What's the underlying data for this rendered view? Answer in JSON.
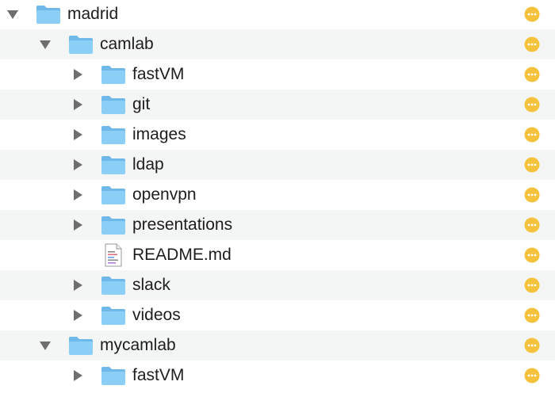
{
  "rows": [
    {
      "label": "madrid",
      "level": 0,
      "kind": "folder",
      "expanded": true
    },
    {
      "label": "camlab",
      "level": 1,
      "kind": "folder",
      "expanded": true
    },
    {
      "label": "fastVM",
      "level": 2,
      "kind": "folder",
      "expanded": false
    },
    {
      "label": "git",
      "level": 2,
      "kind": "folder",
      "expanded": false
    },
    {
      "label": "images",
      "level": 2,
      "kind": "folder",
      "expanded": false
    },
    {
      "label": "ldap",
      "level": 2,
      "kind": "folder",
      "expanded": false
    },
    {
      "label": "openvpn",
      "level": 2,
      "kind": "folder",
      "expanded": false
    },
    {
      "label": "presentations",
      "level": 2,
      "kind": "folder",
      "expanded": false
    },
    {
      "label": "README.md",
      "level": 2,
      "kind": "file",
      "expanded": false
    },
    {
      "label": "slack",
      "level": 2,
      "kind": "folder",
      "expanded": false
    },
    {
      "label": "videos",
      "level": 2,
      "kind": "folder",
      "expanded": false
    },
    {
      "label": "mycamlab",
      "level": 1,
      "kind": "folder",
      "expanded": true
    },
    {
      "label": "fastVM",
      "level": 2,
      "kind": "folder",
      "expanded": false
    }
  ],
  "icons": {
    "folder": "folder-icon",
    "file": "document-icon",
    "expanded": "disclosure-expanded-icon",
    "collapsed": "disclosure-collapsed-icon",
    "action": "more-options-icon"
  },
  "colors": {
    "folder_fill": "#8ccff6",
    "folder_tab": "#6fb9ea",
    "disclosure": "#6e6e6e",
    "action_fill": "#f5c33b",
    "stripe": "#f4f5f5"
  }
}
